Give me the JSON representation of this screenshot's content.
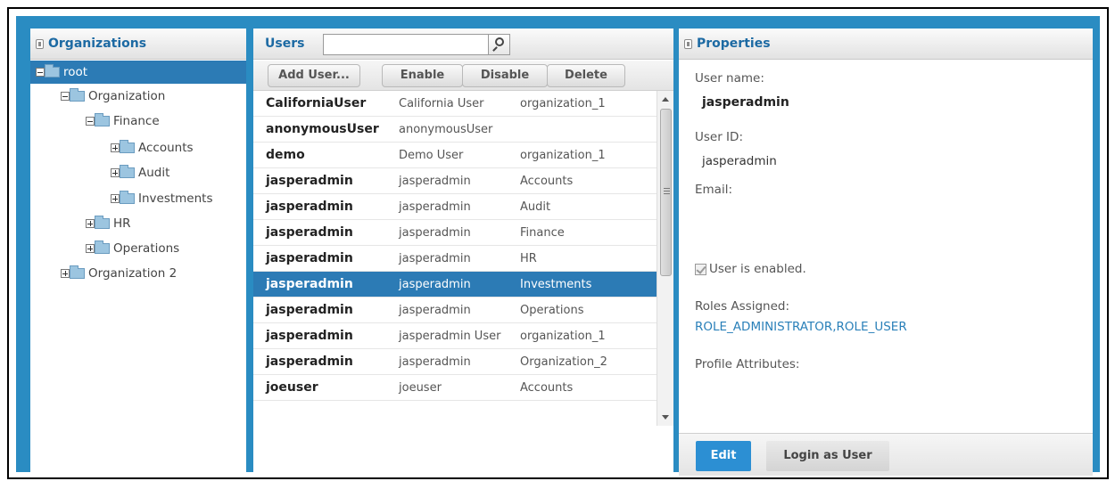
{
  "organizations": {
    "title": "Organizations",
    "tree": [
      {
        "label": "root",
        "expanded": true,
        "selected": true
      },
      {
        "label": "Organization",
        "expanded": true
      },
      {
        "label": "Finance",
        "expanded": true
      },
      {
        "label": "Accounts",
        "expanded": false
      },
      {
        "label": "Audit",
        "expanded": false
      },
      {
        "label": "Investments",
        "expanded": false
      },
      {
        "label": "HR",
        "expanded": false
      },
      {
        "label": "Operations",
        "expanded": false
      },
      {
        "label": "Organization 2",
        "expanded": false
      }
    ]
  },
  "users": {
    "title": "Users",
    "search": {
      "value": "",
      "icon": "search-icon"
    },
    "toolbar": {
      "add_label": "Add User...",
      "enable_label": "Enable",
      "disable_label": "Disable",
      "delete_label": "Delete"
    },
    "rows": [
      {
        "name": "CaliforniaUser",
        "full": "California User",
        "org": "organization_1"
      },
      {
        "name": "anonymousUser",
        "full": "anonymousUser",
        "org": ""
      },
      {
        "name": "demo",
        "full": "Demo User",
        "org": "organization_1"
      },
      {
        "name": "jasperadmin",
        "full": "jasperadmin",
        "org": "Accounts"
      },
      {
        "name": "jasperadmin",
        "full": "jasperadmin",
        "org": "Audit"
      },
      {
        "name": "jasperadmin",
        "full": "jasperadmin",
        "org": "Finance"
      },
      {
        "name": "jasperadmin",
        "full": "jasperadmin",
        "org": "HR"
      },
      {
        "name": "jasperadmin",
        "full": "jasperadmin",
        "org": "Investments",
        "selected": true
      },
      {
        "name": "jasperadmin",
        "full": "jasperadmin",
        "org": "Operations"
      },
      {
        "name": "jasperadmin",
        "full": "jasperadmin User",
        "org": "organization_1"
      },
      {
        "name": "jasperadmin",
        "full": "jasperadmin",
        "org": "Organization_2"
      },
      {
        "name": "joeuser",
        "full": "joeuser",
        "org": "Accounts"
      }
    ]
  },
  "properties": {
    "title": "Properties",
    "username_label": "User name:",
    "username_value": "jasperadmin",
    "userid_label": "User ID:",
    "userid_value": "jasperadmin",
    "email_label": "Email:",
    "enabled_label": "User is enabled.",
    "roles_label": "Roles Assigned:",
    "roles_value": "ROLE_ADMINISTRATOR,ROLE_USER",
    "profile_label": "Profile Attributes:",
    "edit_label": "Edit",
    "login_label": "Login as User"
  },
  "colors": {
    "accent": "#2a8cc2",
    "selection": "#2c7bb5",
    "title_text": "#1d6aa3",
    "link": "#2a80b9"
  }
}
